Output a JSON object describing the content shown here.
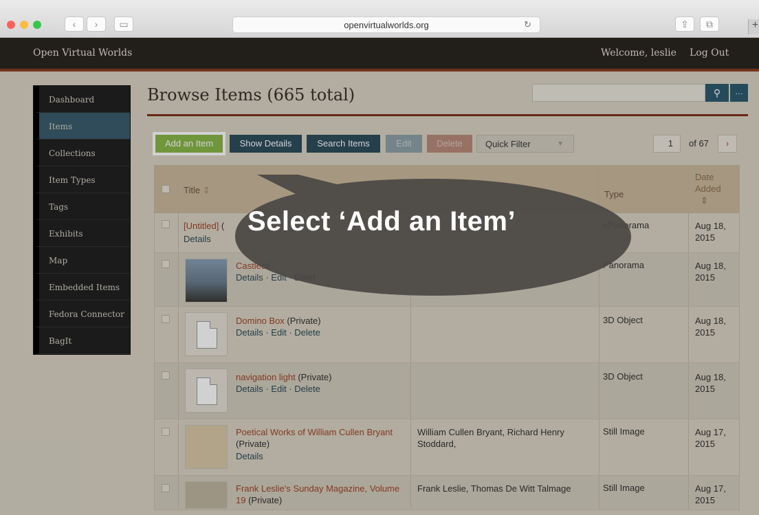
{
  "browser": {
    "url": "openvirtualworlds.org",
    "traffic_colors": [
      "#fc605c",
      "#fdbc40",
      "#34c84a"
    ]
  },
  "header": {
    "brand": "Open Virtual Worlds",
    "welcome": "Welcome, leslie",
    "logout": "Log Out"
  },
  "sidebar": {
    "items": [
      {
        "label": "Dashboard"
      },
      {
        "label": "Items"
      },
      {
        "label": "Collections"
      },
      {
        "label": "Item Types"
      },
      {
        "label": "Tags"
      },
      {
        "label": "Exhibits"
      },
      {
        "label": "Map"
      },
      {
        "label": "Embedded Items"
      },
      {
        "label": "Fedora Connector"
      },
      {
        "label": "BagIt"
      }
    ],
    "active": "Items"
  },
  "main": {
    "title": "Browse Items (665 total)",
    "toolbar": {
      "add": "Add an Item",
      "show_details": "Show Details",
      "search_items": "Search Items",
      "edit": "Edit",
      "delete": "Delete",
      "quick_filter": "Quick Filter"
    },
    "pagination": {
      "page": "1",
      "of": "of 67"
    },
    "table": {
      "headers": {
        "title": "Title",
        "type": "Type",
        "date_line1": "Date",
        "date_line2": "Added"
      },
      "rows": [
        {
          "title": "[Untitled]",
          "priv": " (",
          "links": "Details",
          "creator": "",
          "type": "ePanorama",
          "date1": "Aug 18,",
          "date2": "2015"
        },
        {
          "title": "Castlecli",
          "priv": "",
          "links": "Details · Edit · Delet",
          "creator": "",
          "type": "Panorama",
          "date1": "Aug 18,",
          "date2": "2015"
        },
        {
          "title": "Domino Box",
          "priv": " (Private)",
          "links": "Details · Edit · Delete",
          "creator": "",
          "type": "3D Object",
          "date1": "Aug 18,",
          "date2": "2015"
        },
        {
          "title": "navigation light",
          "priv": " (Private)",
          "links": "Details · Edit · Delete",
          "creator": "",
          "type": "3D Object",
          "date1": "Aug 18,",
          "date2": "2015"
        },
        {
          "title": "Poetical Works of William Cullen Bryant",
          "priv": " (Private)",
          "links": "Details",
          "creator": "William Cullen Bryant, Richard Henry Stoddard,",
          "type": "Still Image",
          "date1": "Aug 17,",
          "date2": "2015"
        },
        {
          "title": "Frank Leslie's Sunday Magazine, Volume 19",
          "priv": " (Private)",
          "links": "",
          "creator": "Frank Leslie, Thomas De Witt Talmage",
          "type": "Still Image",
          "date1": "Aug 17,",
          "date2": "2015"
        }
      ]
    }
  },
  "callout": {
    "text": "Select ‘Add an Item’"
  }
}
